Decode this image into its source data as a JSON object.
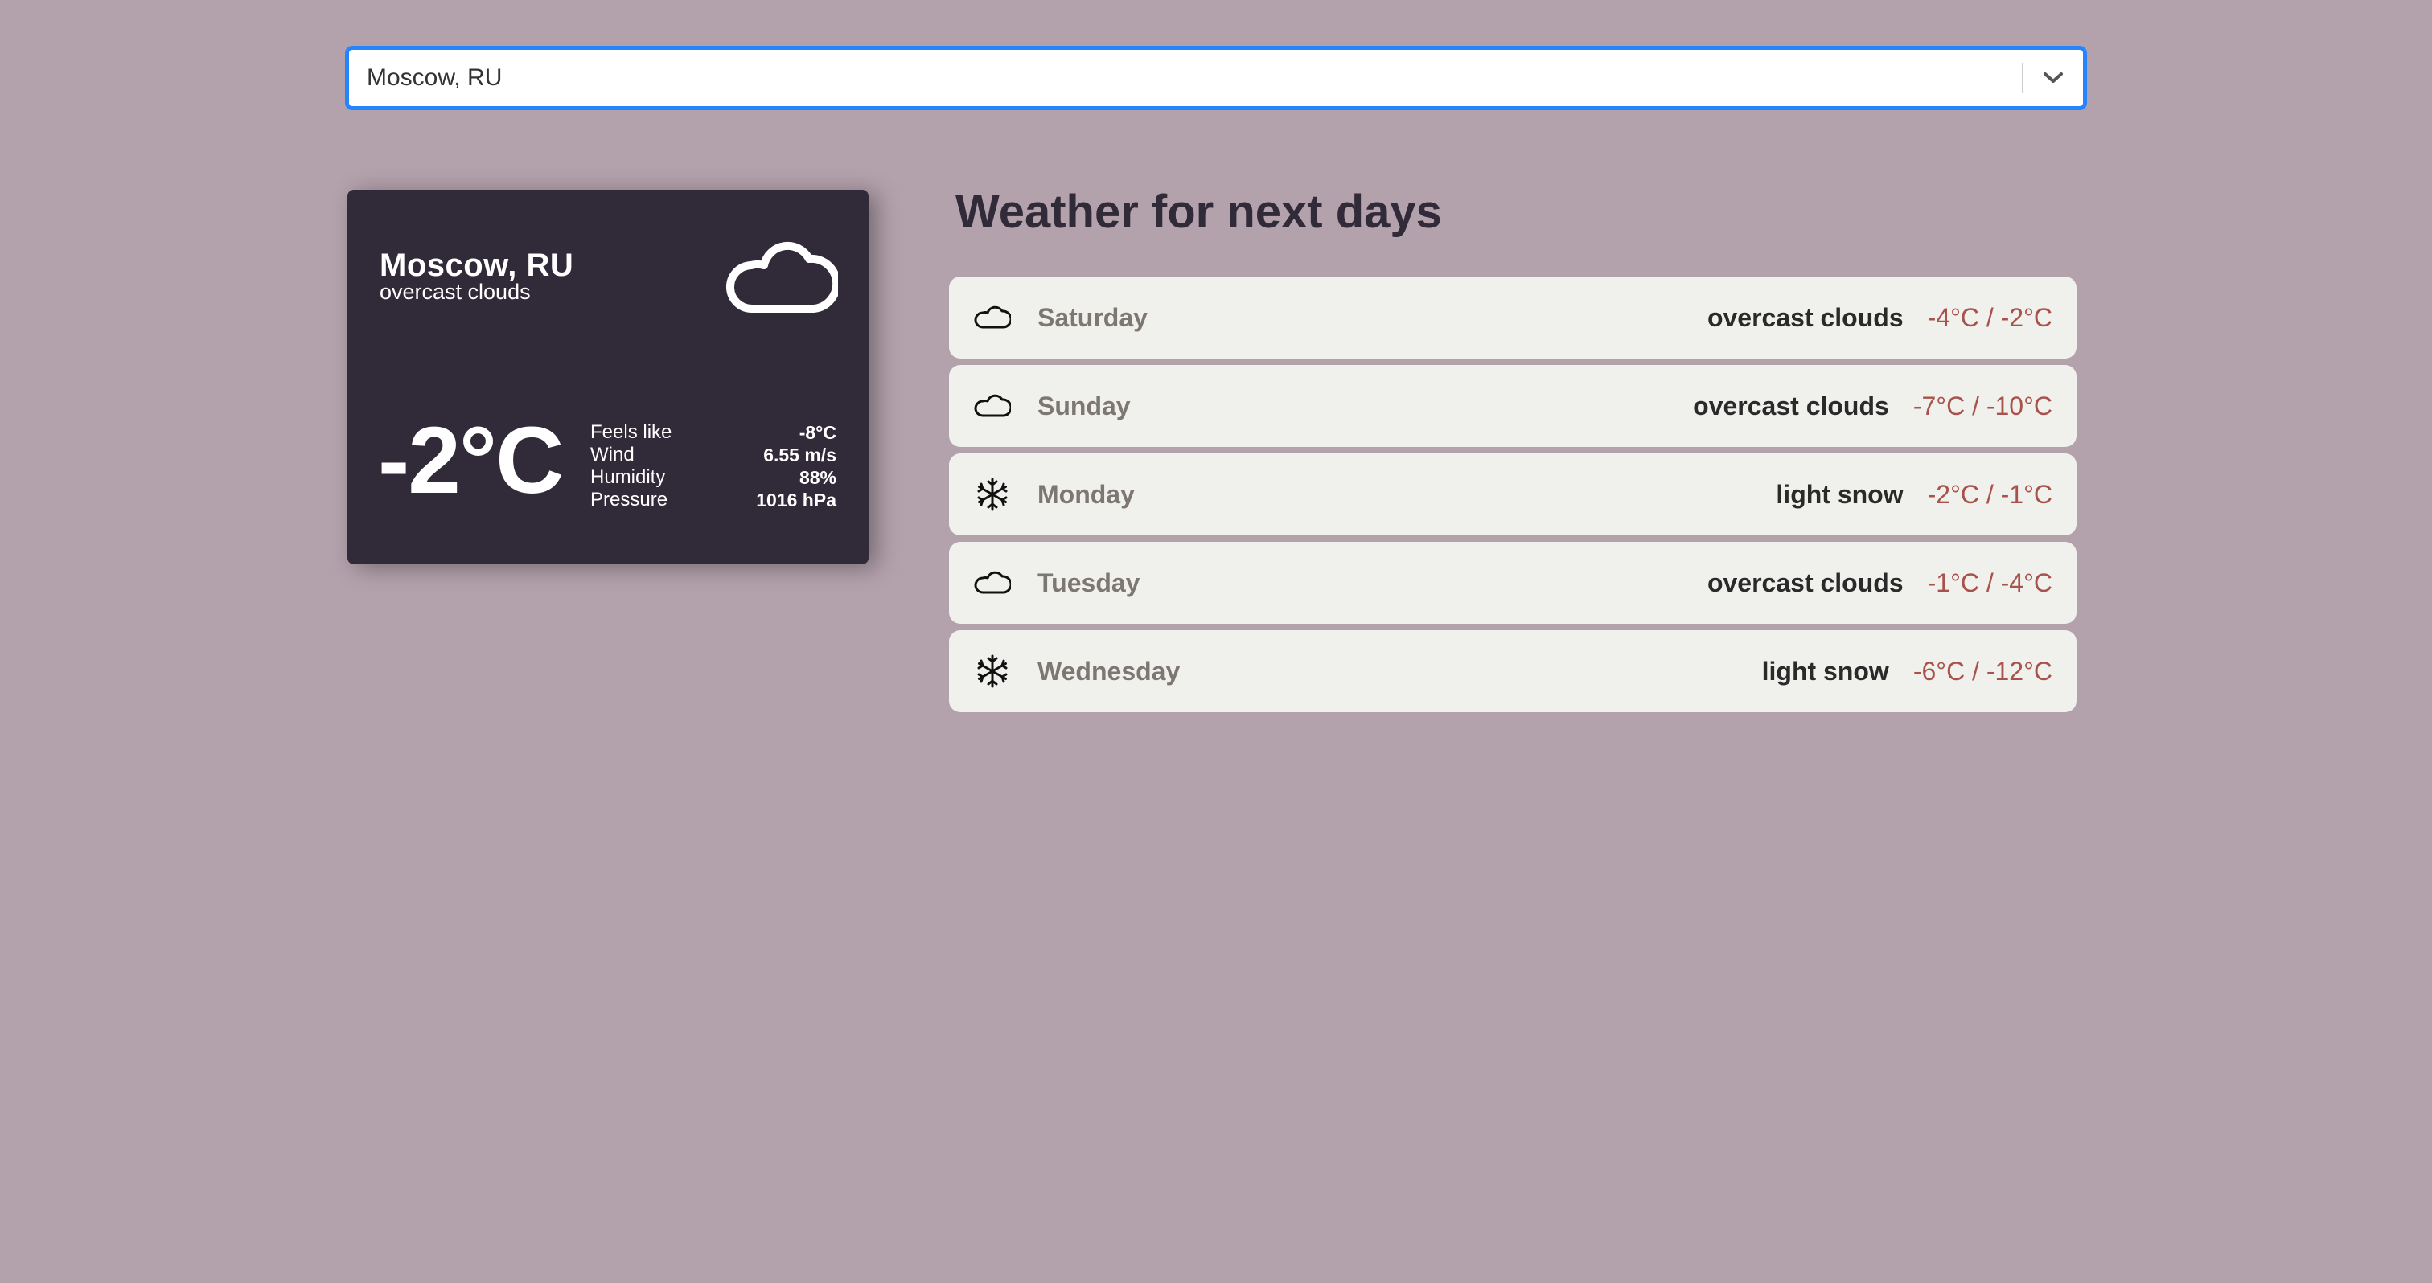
{
  "search": {
    "value": "Moscow, RU",
    "dropdown_icon": "chevron-down-icon"
  },
  "current": {
    "city": "Moscow, RU",
    "description": "overcast clouds",
    "icon": "cloud-icon",
    "temperature": "-2°C",
    "details": [
      {
        "label": "Feels like",
        "value": "-8°C"
      },
      {
        "label": "Wind",
        "value": "6.55 m/s"
      },
      {
        "label": "Humidity",
        "value": "88%"
      },
      {
        "label": "Pressure",
        "value": "1016 hPa"
      }
    ]
  },
  "forecast": {
    "title": "Weather for next days",
    "days": [
      {
        "day": "Saturday",
        "icon": "cloud-icon",
        "description": "overcast clouds",
        "temps": "-4°C / -2°C"
      },
      {
        "day": "Sunday",
        "icon": "cloud-icon",
        "description": "overcast clouds",
        "temps": "-7°C / -10°C"
      },
      {
        "day": "Monday",
        "icon": "snowflake-icon",
        "description": "light snow",
        "temps": "-2°C / -1°C"
      },
      {
        "day": "Tuesday",
        "icon": "cloud-icon",
        "description": "overcast clouds",
        "temps": "-1°C / -4°C"
      },
      {
        "day": "Wednesday",
        "icon": "snowflake-icon",
        "description": "light snow",
        "temps": "-6°C / -12°C"
      }
    ]
  },
  "colors": {
    "background": "#b3a1ac",
    "card": "#312a38",
    "forecast_item": "#f0f0ec",
    "temp_text": "#a8524b",
    "focus_border": "#2684ff"
  }
}
